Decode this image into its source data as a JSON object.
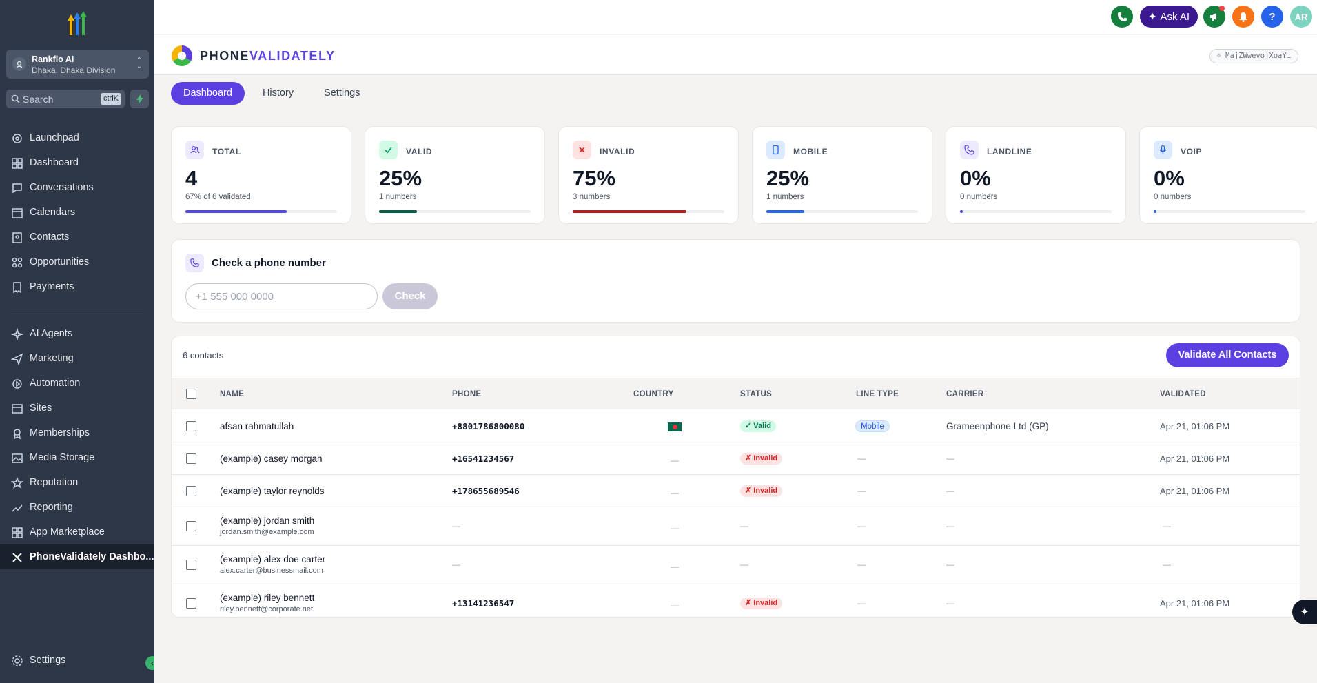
{
  "sidebar": {
    "account_name": "Rankflo AI",
    "account_location": "Dhaka, Dhaka Division",
    "search_placeholder": "Search",
    "search_shortcut": "ctrlK",
    "nav": [
      {
        "label": "Launchpad",
        "icon": "launchpad-icon"
      },
      {
        "label": "Dashboard",
        "icon": "dashboard-icon"
      },
      {
        "label": "Conversations",
        "icon": "chat-icon"
      },
      {
        "label": "Calendars",
        "icon": "calendar-icon"
      },
      {
        "label": "Contacts",
        "icon": "contacts-icon"
      },
      {
        "label": "Opportunities",
        "icon": "opportunities-icon"
      },
      {
        "label": "Payments",
        "icon": "receipt-icon"
      }
    ],
    "nav2": [
      {
        "label": "AI Agents",
        "icon": "sparkle-icon"
      },
      {
        "label": "Marketing",
        "icon": "send-icon"
      },
      {
        "label": "Automation",
        "icon": "automation-icon"
      },
      {
        "label": "Sites",
        "icon": "sites-icon"
      },
      {
        "label": "Memberships",
        "icon": "membership-icon"
      },
      {
        "label": "Media Storage",
        "icon": "image-icon"
      },
      {
        "label": "Reputation",
        "icon": "star-icon"
      },
      {
        "label": "Reporting",
        "icon": "chart-icon"
      },
      {
        "label": "App Marketplace",
        "icon": "grid-icon"
      },
      {
        "label": "PhoneValidately Dashbo...",
        "icon": "phonevalidately-icon",
        "active": true
      }
    ],
    "settings_label": "Settings"
  },
  "topbar": {
    "ask_ai_label": "Ask AI",
    "avatar_initials": "AR"
  },
  "app": {
    "brand_prefix": "PHONE",
    "brand_suffix": "VALIDATELY",
    "api_key": "MajZWwevojXoaY…",
    "tabs": [
      "Dashboard",
      "History",
      "Settings"
    ],
    "active_tab": "Dashboard"
  },
  "stats": [
    {
      "label": "TOTAL",
      "value": "4",
      "sub": "67% of 6 validated",
      "fill": 0.67,
      "color": "#4f46e5",
      "icon": "users-icon",
      "icon_bg": "#ede9fe"
    },
    {
      "label": "VALID",
      "value": "25%",
      "sub": "1 numbers",
      "fill": 0.25,
      "color": "#065f46",
      "icon": "check-icon",
      "icon_bg": "#d1fae5"
    },
    {
      "label": "INVALID",
      "value": "75%",
      "sub": "3 numbers",
      "fill": 0.75,
      "color": "#b91c1c",
      "icon": "x-icon",
      "icon_bg": "#fee2e2"
    },
    {
      "label": "MOBILE",
      "value": "25%",
      "sub": "1 numbers",
      "fill": 0.25,
      "color": "#2563eb",
      "icon": "mobile-icon",
      "icon_bg": "#dbeafe"
    },
    {
      "label": "LANDLINE",
      "value": "0%",
      "sub": "0 numbers",
      "fill": 0.0,
      "color": "#4f46e5",
      "icon": "phone-icon",
      "icon_bg": "#ede9fe"
    },
    {
      "label": "VOIP",
      "value": "0%",
      "sub": "0 numbers",
      "fill": 0.0,
      "color": "#2563eb",
      "icon": "mic-icon",
      "icon_bg": "#dbeafe"
    }
  ],
  "check": {
    "title": "Check a phone number",
    "placeholder": "+1 555 000 0000",
    "button": "Check"
  },
  "table": {
    "count": "6 contacts",
    "validate_all": "Validate All Contacts",
    "columns": [
      "NAME",
      "PHONE",
      "COUNTRY",
      "STATUS",
      "LINE TYPE",
      "CARRIER",
      "VALIDATED"
    ],
    "rows": [
      {
        "name": "afsan rahmatullah",
        "email": "",
        "phone": "+8801786800080",
        "country": "BD",
        "status": "✓ Valid",
        "line_type": "Mobile",
        "carrier": "Grameenphone Ltd (GP)",
        "validated": "Apr 21, 01:06 PM"
      },
      {
        "name": "(example) casey morgan",
        "email": "",
        "phone": "+16541234567",
        "country": "",
        "status": "✗ Invalid",
        "line_type": "",
        "carrier": "",
        "validated": "Apr 21, 01:06 PM"
      },
      {
        "name": "(example) taylor reynolds",
        "email": "",
        "phone": "+178655689546",
        "country": "",
        "status": "✗ Invalid",
        "line_type": "",
        "carrier": "",
        "validated": "Apr 21, 01:06 PM"
      },
      {
        "name": "(example) jordan smith",
        "email": "jordan.smith@example.com",
        "phone": "",
        "country": "",
        "status": "",
        "line_type": "",
        "carrier": "",
        "validated": ""
      },
      {
        "name": "(example) alex doe carter",
        "email": "alex.carter@businessmail.com",
        "phone": "",
        "country": "",
        "status": "",
        "line_type": "",
        "carrier": "",
        "validated": ""
      },
      {
        "name": "(example) riley bennett",
        "email": "riley.bennett@corporate.net",
        "phone": "+13141236547",
        "country": "",
        "status": "✗ Invalid",
        "line_type": "",
        "carrier": "",
        "validated": "Apr 21, 01:06 PM"
      }
    ],
    "empty": "—"
  }
}
